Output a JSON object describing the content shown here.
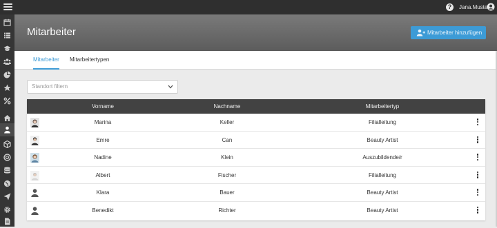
{
  "topbar": {
    "user_name": "Jana.Muster",
    "help": "?"
  },
  "sidebar": {
    "items": [
      {
        "icon": "calendar-icon"
      },
      {
        "icon": "list-icon"
      },
      {
        "icon": "graduation-cap-icon"
      },
      {
        "icon": "group-icon"
      },
      {
        "icon": "pie-chart-icon"
      },
      {
        "icon": "star-icon"
      },
      {
        "icon": "percent-icon"
      },
      {
        "icon": "home-icon"
      },
      {
        "icon": "user-icon",
        "active": true
      },
      {
        "icon": "cube-icon"
      },
      {
        "icon": "life-ring-icon"
      },
      {
        "icon": "database-icon"
      },
      {
        "icon": "globe-icon"
      },
      {
        "icon": "send-icon"
      },
      {
        "icon": "cog-icon"
      },
      {
        "icon": "document-icon"
      }
    ]
  },
  "header": {
    "title": "Mitarbeiter",
    "add_button": "Mitarbeiter hinzufügen"
  },
  "tabs": [
    {
      "label": "Mitarbeiter",
      "active": true
    },
    {
      "label": "Mitarbeitertypen",
      "active": false
    }
  ],
  "filter": {
    "placeholder": "Standort filtern"
  },
  "table": {
    "columns": [
      "Vorname",
      "Nachname",
      "Mitarbeitertyp"
    ],
    "rows": [
      {
        "first": "Marina",
        "last": "Keller",
        "type": "Filialleitung",
        "avatar": "photo"
      },
      {
        "first": "Emre",
        "last": "Can",
        "type": "Beauty Artist",
        "avatar": "photo"
      },
      {
        "first": "Nadine",
        "last": "Klein",
        "type": "Auszubildende/r",
        "avatar": "photo"
      },
      {
        "first": "Albert",
        "last": "Fischer",
        "type": "Filialleitung",
        "avatar": "photo"
      },
      {
        "first": "Klara",
        "last": "Bauer",
        "type": "Beauty Artist",
        "avatar": "placeholder"
      },
      {
        "first": "Benedikt",
        "last": "Richter",
        "type": "Beauty Artist",
        "avatar": "placeholder"
      }
    ]
  },
  "colors": {
    "accent": "#3d9bd6",
    "topbar": "#2f2f2f",
    "table_header": "#424242"
  }
}
